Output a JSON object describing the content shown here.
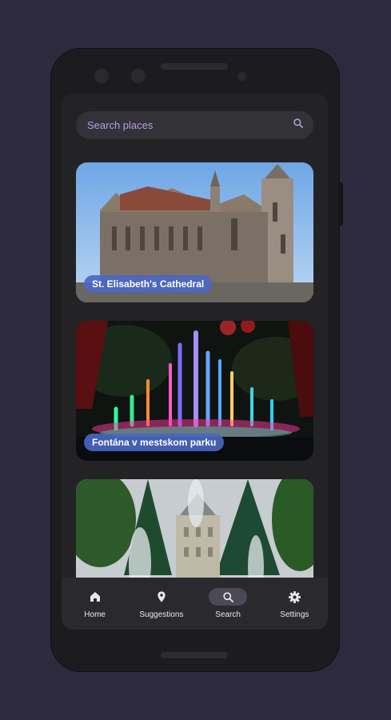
{
  "search": {
    "placeholder": "Search places"
  },
  "places": [
    {
      "name": "St. Elisabeth's Cathedral"
    },
    {
      "name": "Fontána v mestskom parku"
    },
    {
      "name": ""
    }
  ],
  "nav": {
    "items": [
      {
        "label": "Home",
        "icon": "home-icon"
      },
      {
        "label": "Suggestions",
        "icon": "location-pin-icon"
      },
      {
        "label": "Search",
        "icon": "search-icon"
      },
      {
        "label": "Settings",
        "icon": "gear-icon"
      }
    ],
    "active": "Search"
  },
  "colors": {
    "background": "#2e2a3d",
    "accent": "#b79ee8",
    "label_bg": "#4a67c4"
  }
}
